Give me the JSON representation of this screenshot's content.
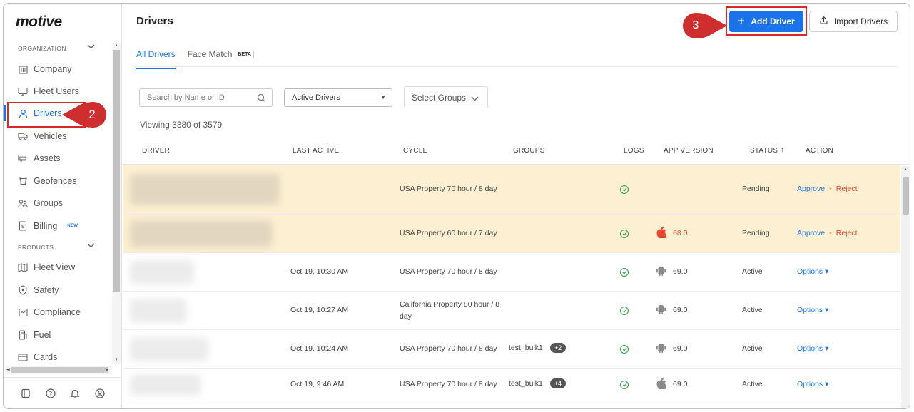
{
  "app": {
    "logo": "motive"
  },
  "sidebar": {
    "organization_label": "ORGANIZATION",
    "products_label": "PRODUCTS",
    "org_items": [
      {
        "label": "Company",
        "icon": "building-icon"
      },
      {
        "label": "Fleet Users",
        "icon": "monitor-icon"
      },
      {
        "label": "Drivers",
        "icon": "person-icon"
      },
      {
        "label": "Vehicles",
        "icon": "truck-icon"
      },
      {
        "label": "Assets",
        "icon": "trailer-icon"
      },
      {
        "label": "Geofences",
        "icon": "geofence-icon"
      },
      {
        "label": "Groups",
        "icon": "groups-icon"
      },
      {
        "label": "Billing",
        "icon": "billing-icon",
        "badge": "NEW"
      }
    ],
    "product_items": [
      {
        "label": "Fleet View",
        "icon": "map-icon"
      },
      {
        "label": "Safety",
        "icon": "shield-icon"
      },
      {
        "label": "Compliance",
        "icon": "compliance-icon"
      },
      {
        "label": "Fuel",
        "icon": "fuel-icon"
      },
      {
        "label": "Cards",
        "icon": "card-icon"
      }
    ],
    "active_item": "Drivers"
  },
  "callouts": {
    "step2": "2",
    "step3": "3"
  },
  "header": {
    "title": "Drivers",
    "add_driver_label": "Add Driver",
    "import_drivers_label": "Import Drivers"
  },
  "tabs": [
    {
      "label": "All Drivers",
      "active": true
    },
    {
      "label": "Face Match",
      "badge": "BETA"
    }
  ],
  "filters": {
    "search_placeholder": "Search by Name or ID",
    "status_select": "Active Drivers",
    "groups_select": "Select Groups"
  },
  "viewing_text": "Viewing 3380 of 3579",
  "table": {
    "columns": [
      "DRIVER",
      "LAST ACTIVE",
      "CYCLE",
      "GROUPS",
      "LOGS",
      "APP VERSION",
      "STATUS",
      "ACTION"
    ],
    "status_sort_indicator": "↑",
    "rows": [
      {
        "last_active": "",
        "cycle": "USA Property 70 hour / 8 day",
        "cycle2": "",
        "group": "",
        "chip": "",
        "platform": "",
        "app_version": "",
        "status": "Pending",
        "action_a": "Approve",
        "action_b": "Reject",
        "pending": true
      },
      {
        "last_active": "",
        "cycle": "USA Property 60 hour / 7 day",
        "cycle2": "",
        "group": "",
        "chip": "",
        "platform": "apple",
        "app_version": "68.0",
        "status": "Pending",
        "action_a": "Approve",
        "action_b": "Reject",
        "pending": true
      },
      {
        "last_active": "Oct 19, 10:30 AM",
        "cycle": "USA Property 70 hour / 8 day",
        "cycle2": "",
        "group": "",
        "chip": "",
        "platform": "android",
        "app_version": "69.0",
        "status": "Active",
        "action_a": "Options ▾",
        "action_b": ""
      },
      {
        "last_active": "Oct 19, 10:27 AM",
        "cycle": "California Property 80 hour / 8",
        "cycle2": "day",
        "group": "",
        "chip": "",
        "platform": "android",
        "app_version": "69.0",
        "status": "Active",
        "action_a": "Options ▾",
        "action_b": ""
      },
      {
        "last_active": "Oct 19, 10:24 AM",
        "cycle": "USA Property 70 hour / 8 day",
        "cycle2": "",
        "group": "test_bulk1",
        "chip": "+2",
        "platform": "android",
        "app_version": "69.0",
        "status": "Active",
        "action_a": "Options ▾",
        "action_b": ""
      },
      {
        "last_active": "Oct 19, 9:46 AM",
        "cycle": "USA Property 70 hour / 8 day",
        "cycle2": "",
        "group": "test_bulk1",
        "chip": "+4",
        "platform": "apple",
        "app_version": "69.0",
        "status": "Active",
        "action_a": "Options ▾",
        "action_b": ""
      }
    ]
  },
  "colors": {
    "accent": "#1a73e8",
    "pending_bg": "#fdf0d2",
    "callout_red": "#cf2e2e",
    "reject": "#e8462c",
    "logs_ok": "#2ea043"
  }
}
